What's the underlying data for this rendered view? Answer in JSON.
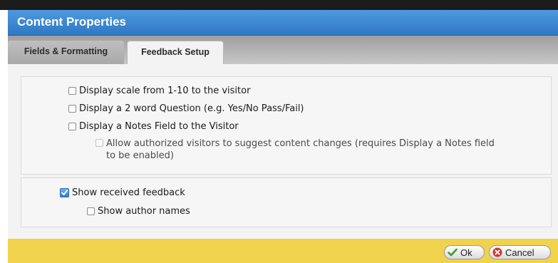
{
  "dialog": {
    "title": "Content Properties"
  },
  "tabs": [
    {
      "label": "Fields & Formatting",
      "active": false
    },
    {
      "label": "Feedback Setup",
      "active": true
    }
  ],
  "feedback": {
    "options": [
      {
        "label": "Display scale from 1-10 to the visitor",
        "checked": false,
        "enabled": true
      },
      {
        "label": "Display a 2 word Question (e.g. Yes/No Pass/Fail)",
        "checked": false,
        "enabled": true
      },
      {
        "label": "Display a Notes Field to the Visitor",
        "checked": false,
        "enabled": true
      },
      {
        "label_line1": "Allow authorized visitors to suggest content changes (requires Display a Notes field",
        "label_line2": "to be enabled)",
        "checked": false,
        "enabled": false
      }
    ],
    "received": [
      {
        "label": "Show received feedback",
        "checked": true,
        "enabled": true
      },
      {
        "label": "Show author names",
        "checked": false,
        "enabled": true
      }
    ]
  },
  "footer": {
    "ok_label": "Ok",
    "cancel_label": "Cancel"
  },
  "colors": {
    "title_bar": "#2f78c4",
    "footer_bar": "#f0d24c",
    "ok_icon": "#3a9a2a",
    "cancel_icon": "#d9342b"
  },
  "icons": {
    "ok": "checkmark-icon",
    "cancel": "x-circle-icon",
    "checkbox_checked": "checkbox-checked-icon"
  }
}
